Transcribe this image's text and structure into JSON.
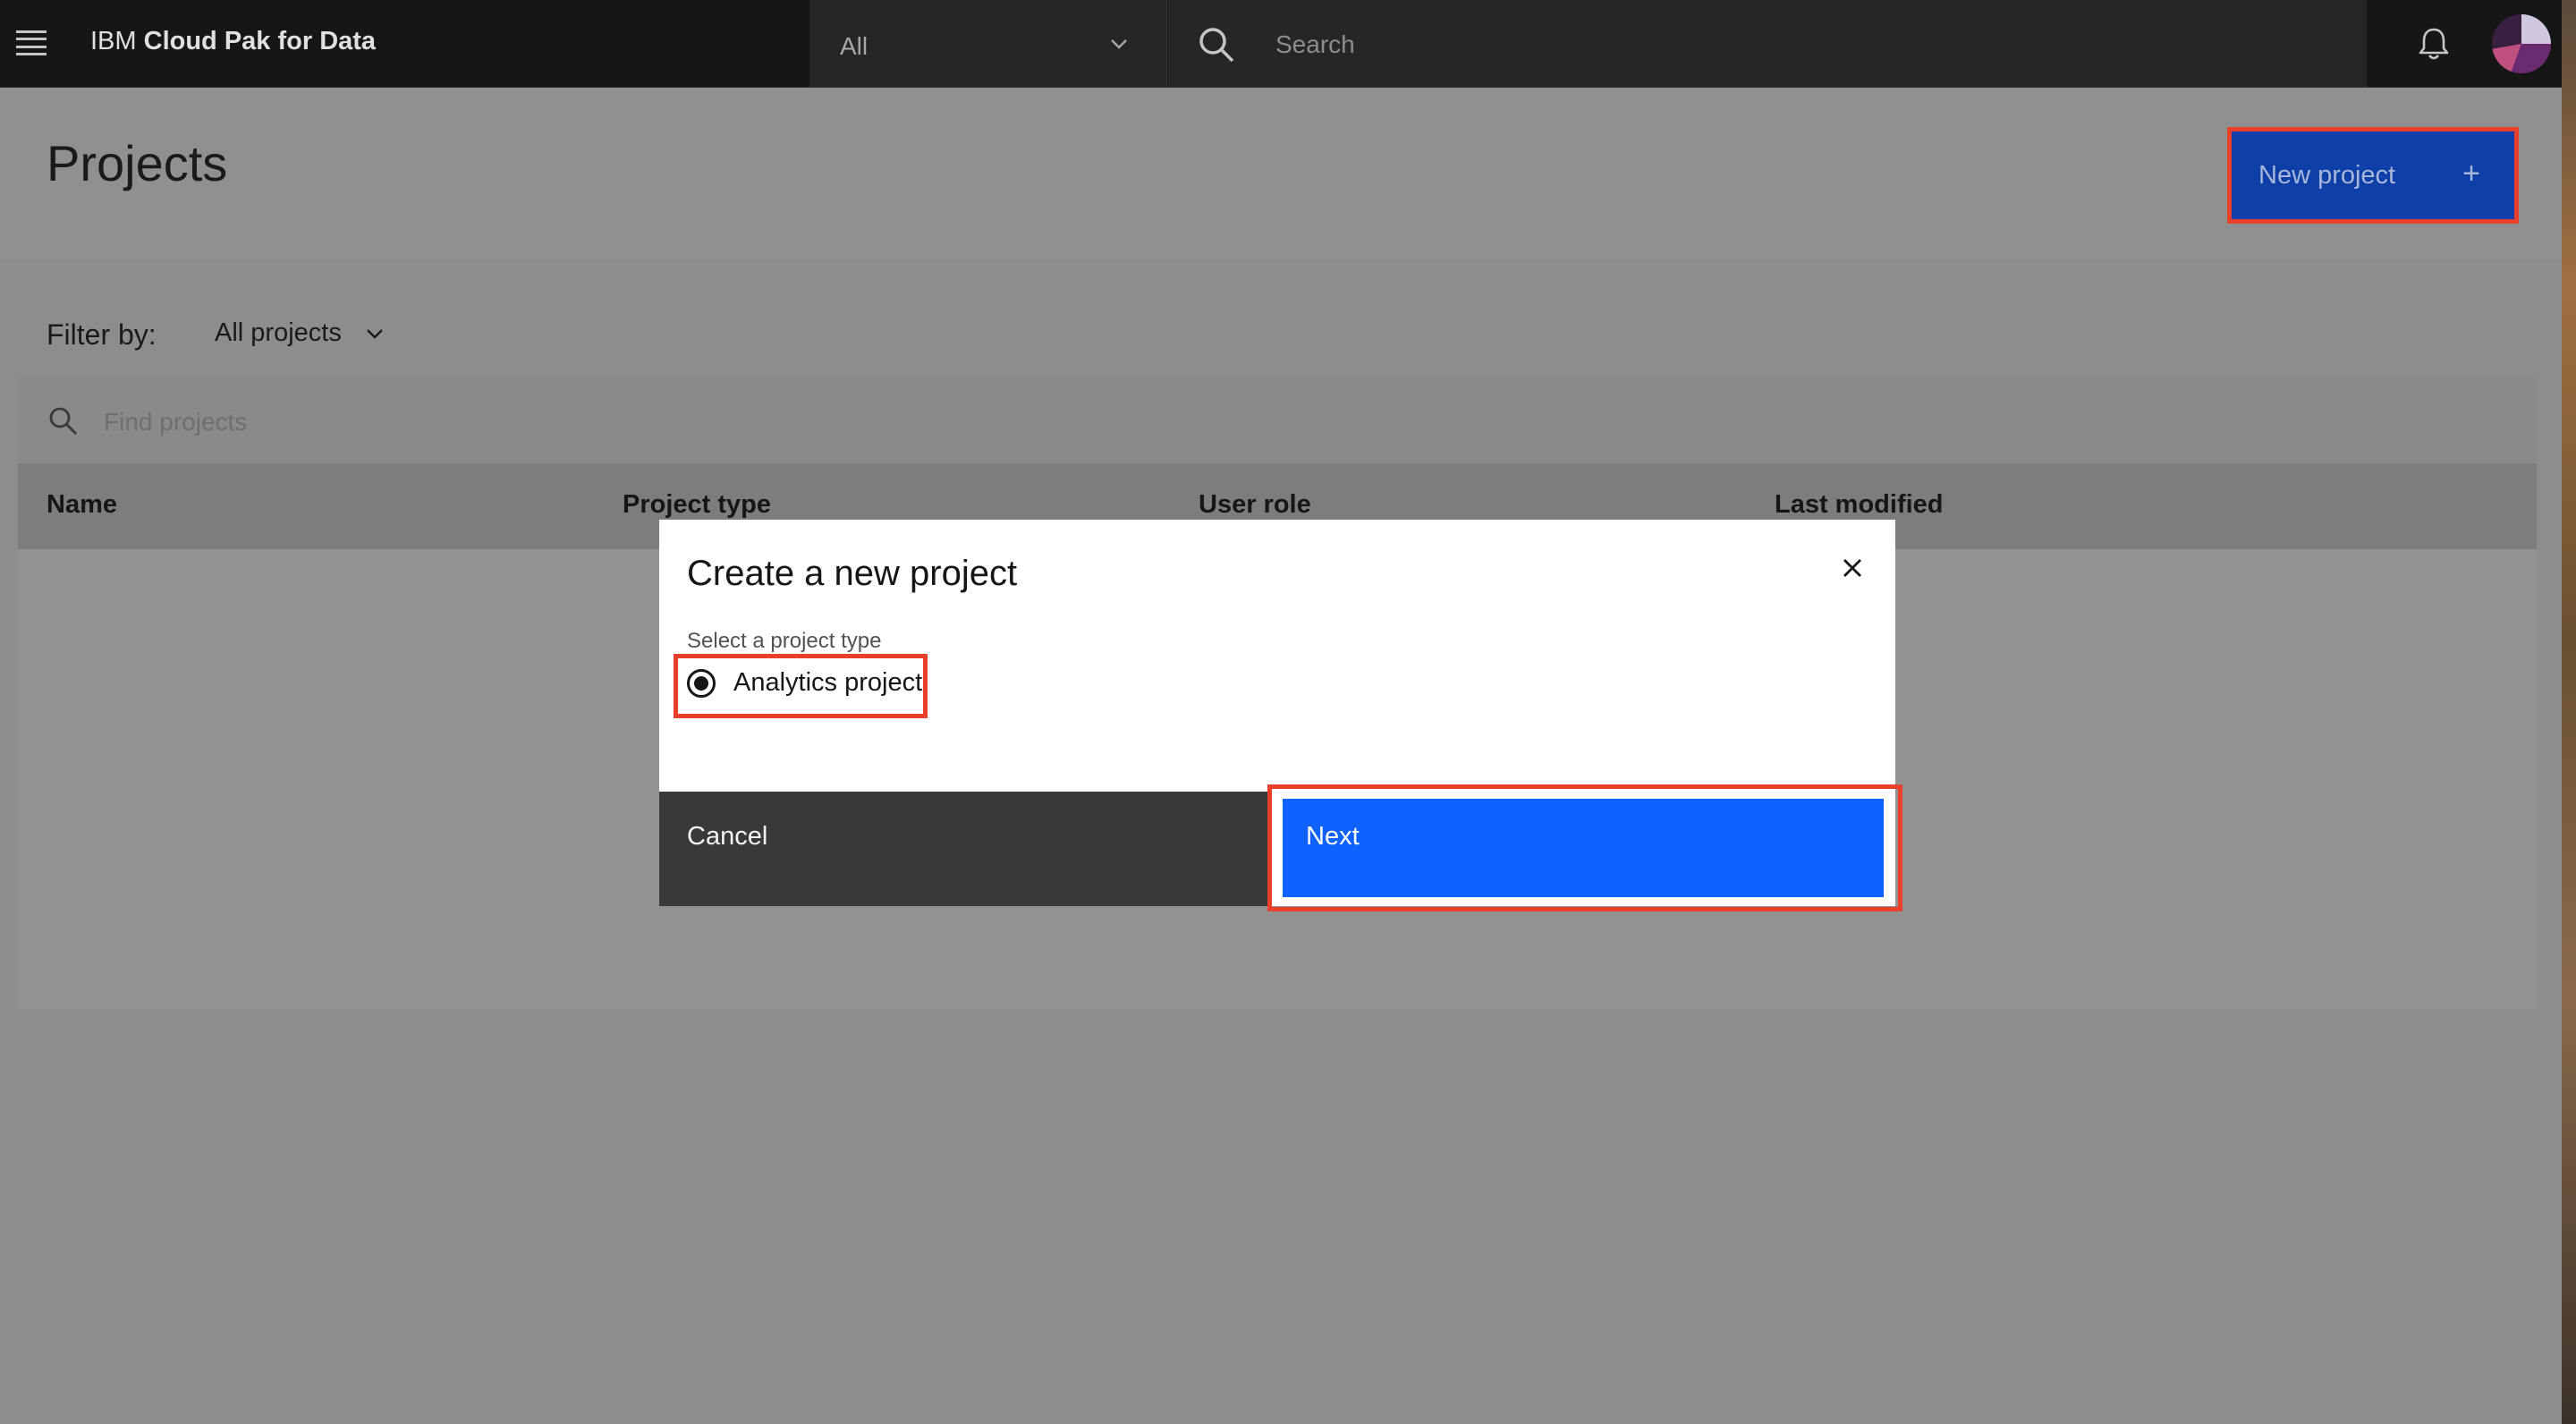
{
  "header": {
    "brand_prefix": "IBM",
    "brand_name": "Cloud Pak for Data",
    "scope_value": "All",
    "search_placeholder": "Search"
  },
  "page": {
    "title": "Projects",
    "new_project_label": "New project",
    "new_project_icon": "+"
  },
  "filter": {
    "label": "Filter by:",
    "value": "All projects"
  },
  "table": {
    "find_placeholder": "Find projects",
    "columns": [
      "Name",
      "Project type",
      "User role",
      "Last modified"
    ]
  },
  "modal": {
    "title": "Create a new project",
    "field_label": "Select a project type",
    "option_label": "Analytics project",
    "cancel_label": "Cancel",
    "next_label": "Next"
  },
  "colors": {
    "header_bg": "#161616",
    "primary_blue": "#0f62fe",
    "highlight_red": "#e8402a"
  }
}
